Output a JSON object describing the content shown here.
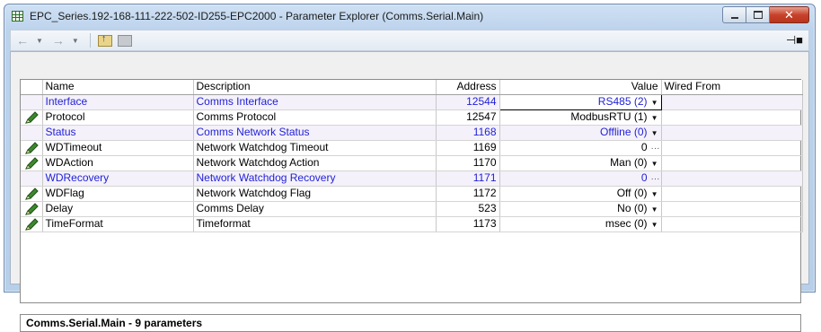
{
  "window": {
    "title": "EPC_Series.192-168-111-222-502-ID255-EPC2000 - Parameter Explorer (Comms.Serial.Main)",
    "icon": "table-icon"
  },
  "toolbar": {
    "back_icon": "back-arrow-icon",
    "forward_icon": "forward-arrow-icon",
    "up_icon": "folder-up-icon",
    "folder_icon": "folder-icon",
    "pin_icon": "pin-icon"
  },
  "columns": {
    "name": "Name",
    "description": "Description",
    "address": "Address",
    "value": "Value",
    "wired_from": "Wired From"
  },
  "rows": [
    {
      "editable": false,
      "linked": true,
      "name": "Interface",
      "description": "Comms Interface",
      "address": "12544",
      "value": "RS485 (2)",
      "control": "dropdown",
      "selected": true
    },
    {
      "editable": true,
      "linked": false,
      "name": "Protocol",
      "description": "Comms Protocol",
      "address": "12547",
      "value": "ModbusRTU (1)",
      "control": "dropdown",
      "selected": false
    },
    {
      "editable": false,
      "linked": true,
      "name": "Status",
      "description": "Comms Network Status",
      "address": "1168",
      "value": "Offline (0)",
      "control": "dropdown",
      "selected": false
    },
    {
      "editable": true,
      "linked": false,
      "name": "WDTimeout",
      "description": "Network Watchdog Timeout",
      "address": "1169",
      "value": "0",
      "control": "ellipsis",
      "selected": false
    },
    {
      "editable": true,
      "linked": false,
      "name": "WDAction",
      "description": "Network Watchdog Action",
      "address": "1170",
      "value": "Man (0)",
      "control": "dropdown",
      "selected": false
    },
    {
      "editable": false,
      "linked": true,
      "name": "WDRecovery",
      "description": "Network Watchdog Recovery",
      "address": "1171",
      "value": "0",
      "control": "ellipsis",
      "selected": false
    },
    {
      "editable": true,
      "linked": false,
      "name": "WDFlag",
      "description": "Network Watchdog Flag",
      "address": "1172",
      "value": "Off (0)",
      "control": "dropdown",
      "selected": false
    },
    {
      "editable": true,
      "linked": false,
      "name": "Delay",
      "description": "Comms Delay",
      "address": "523",
      "value": "No (0)",
      "control": "dropdown",
      "selected": false
    },
    {
      "editable": true,
      "linked": false,
      "name": "TimeFormat",
      "description": "Timeformat",
      "address": "1173",
      "value": "msec (0)",
      "control": "dropdown",
      "selected": false
    }
  ],
  "status": "Comms.Serial.Main  -  9 parameters",
  "colors": {
    "linked_text": "#1f1fd6",
    "pencil": "#3c8a2e"
  }
}
